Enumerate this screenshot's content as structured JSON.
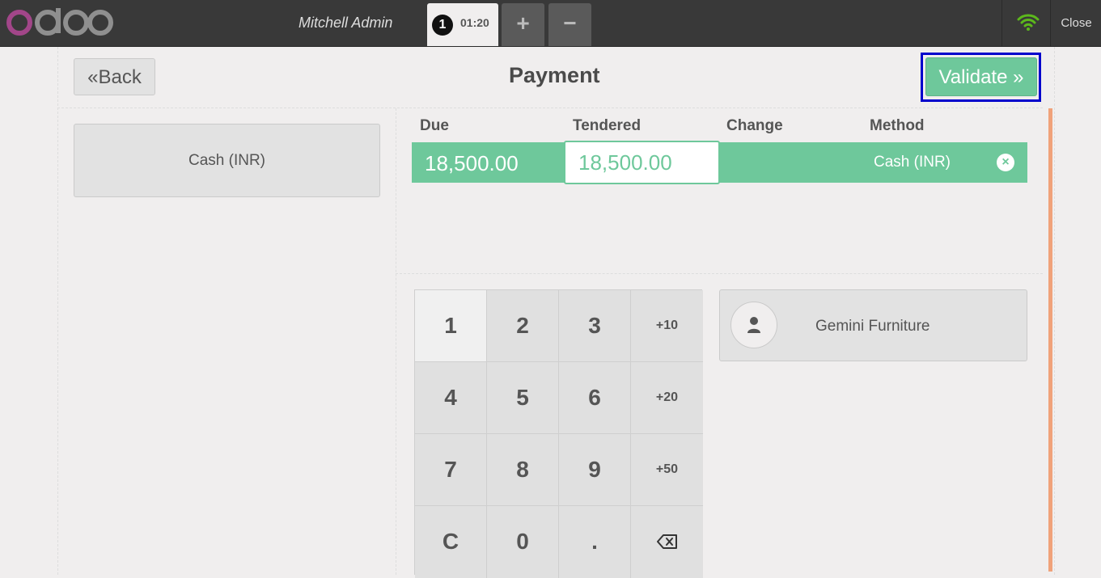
{
  "header": {
    "brand": "odoo",
    "cashier": "Mitchell Admin",
    "order": {
      "number": "1",
      "time": "01:20"
    },
    "add_order_label": "+",
    "remove_order_label": "−",
    "close_label": "Close",
    "wifi_icon": "wifi-icon",
    "status_color": "#5cb81c"
  },
  "payment": {
    "back_label": "Back",
    "title": "Payment",
    "validate_label": "Validate",
    "methods": [
      "Cash (INR)"
    ],
    "columns": {
      "due": "Due",
      "tendered": "Tendered",
      "change": "Change",
      "method": "Method"
    },
    "line": {
      "due": "18,500.00",
      "tendered": "18,500.00",
      "change": "",
      "method": "Cash (INR)"
    },
    "accent_color": "#6ec89b"
  },
  "numpad": {
    "keys": [
      "1",
      "2",
      "3",
      "+10",
      "4",
      "5",
      "6",
      "+20",
      "7",
      "8",
      "9",
      "+50",
      "C",
      "0",
      ".",
      "backspace"
    ]
  },
  "customer": {
    "name": "Gemini Furniture",
    "icon": "user-icon"
  }
}
